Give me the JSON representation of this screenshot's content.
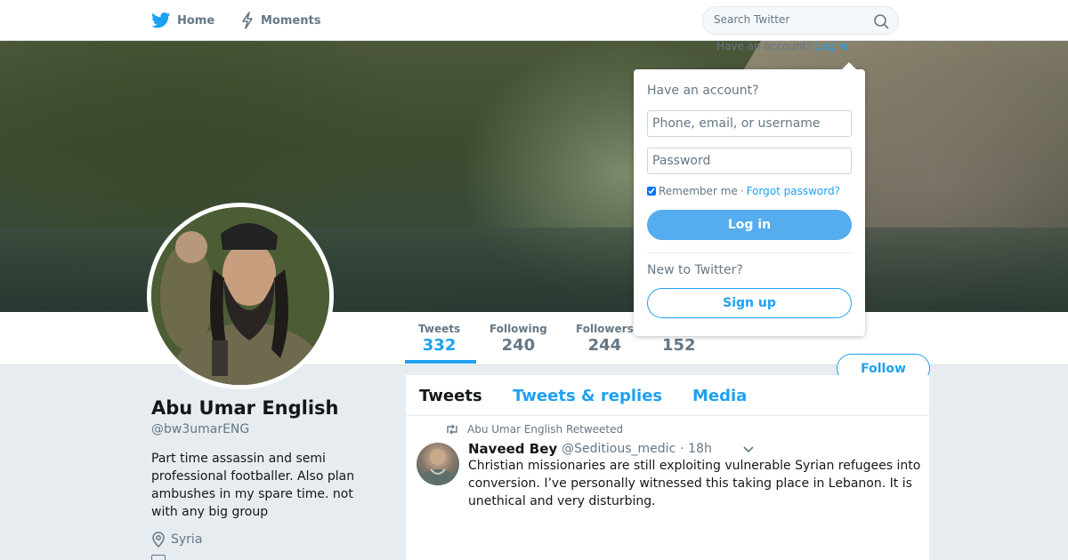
{
  "nav": {
    "home_label": "Home",
    "moments_label": "Moments",
    "home_icon": "twitter-bird-icon",
    "moments_icon": "lightning-icon"
  },
  "search": {
    "placeholder": "Search Twitter",
    "icon": "search-icon"
  },
  "account_prompt": {
    "text": "Have an account?",
    "login_text": "Log in"
  },
  "profile": {
    "name": "Abu Umar English",
    "handle": "@bw3umarENG",
    "bio": "Part time assassin and semi professional footballer. Also plan ambushes in my spare time. not with any big group",
    "location": "Syria",
    "location_icon": "location-pin-icon"
  },
  "stats": [
    {
      "label": "Tweets",
      "value": "332"
    },
    {
      "label": "Following",
      "value": "240"
    },
    {
      "label": "Followers",
      "value": "244"
    },
    {
      "label": "",
      "value": "152"
    }
  ],
  "follow_label": "Follow",
  "timeline": {
    "tabs": [
      "Tweets",
      "Tweets & replies",
      "Media"
    ],
    "retweet_context": "Abu Umar English Retweeted",
    "tweet": {
      "author": "Naveed Bey",
      "handle": "@Seditious_medic",
      "time": "· 18h",
      "text": "Christian missionaries are still exploiting vulnerable Syrian refugees into conversion. I’ve personally witnessed this taking place in Lebanon. It is unethical and very disturbing."
    }
  },
  "login_panel": {
    "heading": "Have an account?",
    "phone_placeholder": "Phone, email, or username",
    "password_placeholder": "Password",
    "remember_label": "Remember me",
    "separator": "·",
    "forgot_label": "Forgot password?",
    "login_button": "Log in",
    "new_label": "New to Twitter?",
    "signup_button": "Sign up"
  },
  "colors": {
    "accent": "#1da1f2",
    "login_button": "#55acee",
    "muted": "#657786",
    "background": "#e6ecf0"
  }
}
